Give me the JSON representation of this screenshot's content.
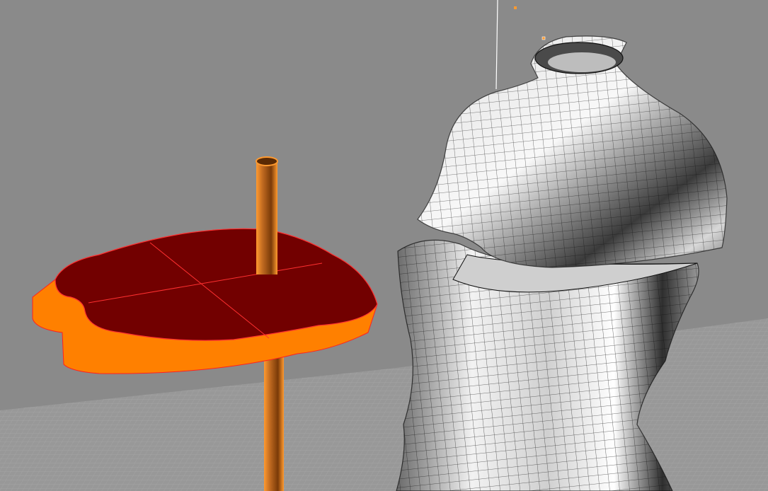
{
  "viewport": {
    "background_color": "#8a8a8a",
    "grid_color": "#9a9a9a",
    "grid_line_color": "#a8a8a8"
  },
  "objects": {
    "table": {
      "top_color": "#720000",
      "side_color": "#ff8000",
      "edge_color": "#ff2020",
      "selected": true
    },
    "pole": {
      "color": "#b05a10",
      "highlight_color": "#ff9a30",
      "selected": true
    },
    "mannequin": {
      "surface_color": "#e8e8e8",
      "shadow_color": "#3a3a3a",
      "mesh_color": "#111111",
      "selected": false
    },
    "control_points": {
      "color": "#ff9a30"
    }
  }
}
